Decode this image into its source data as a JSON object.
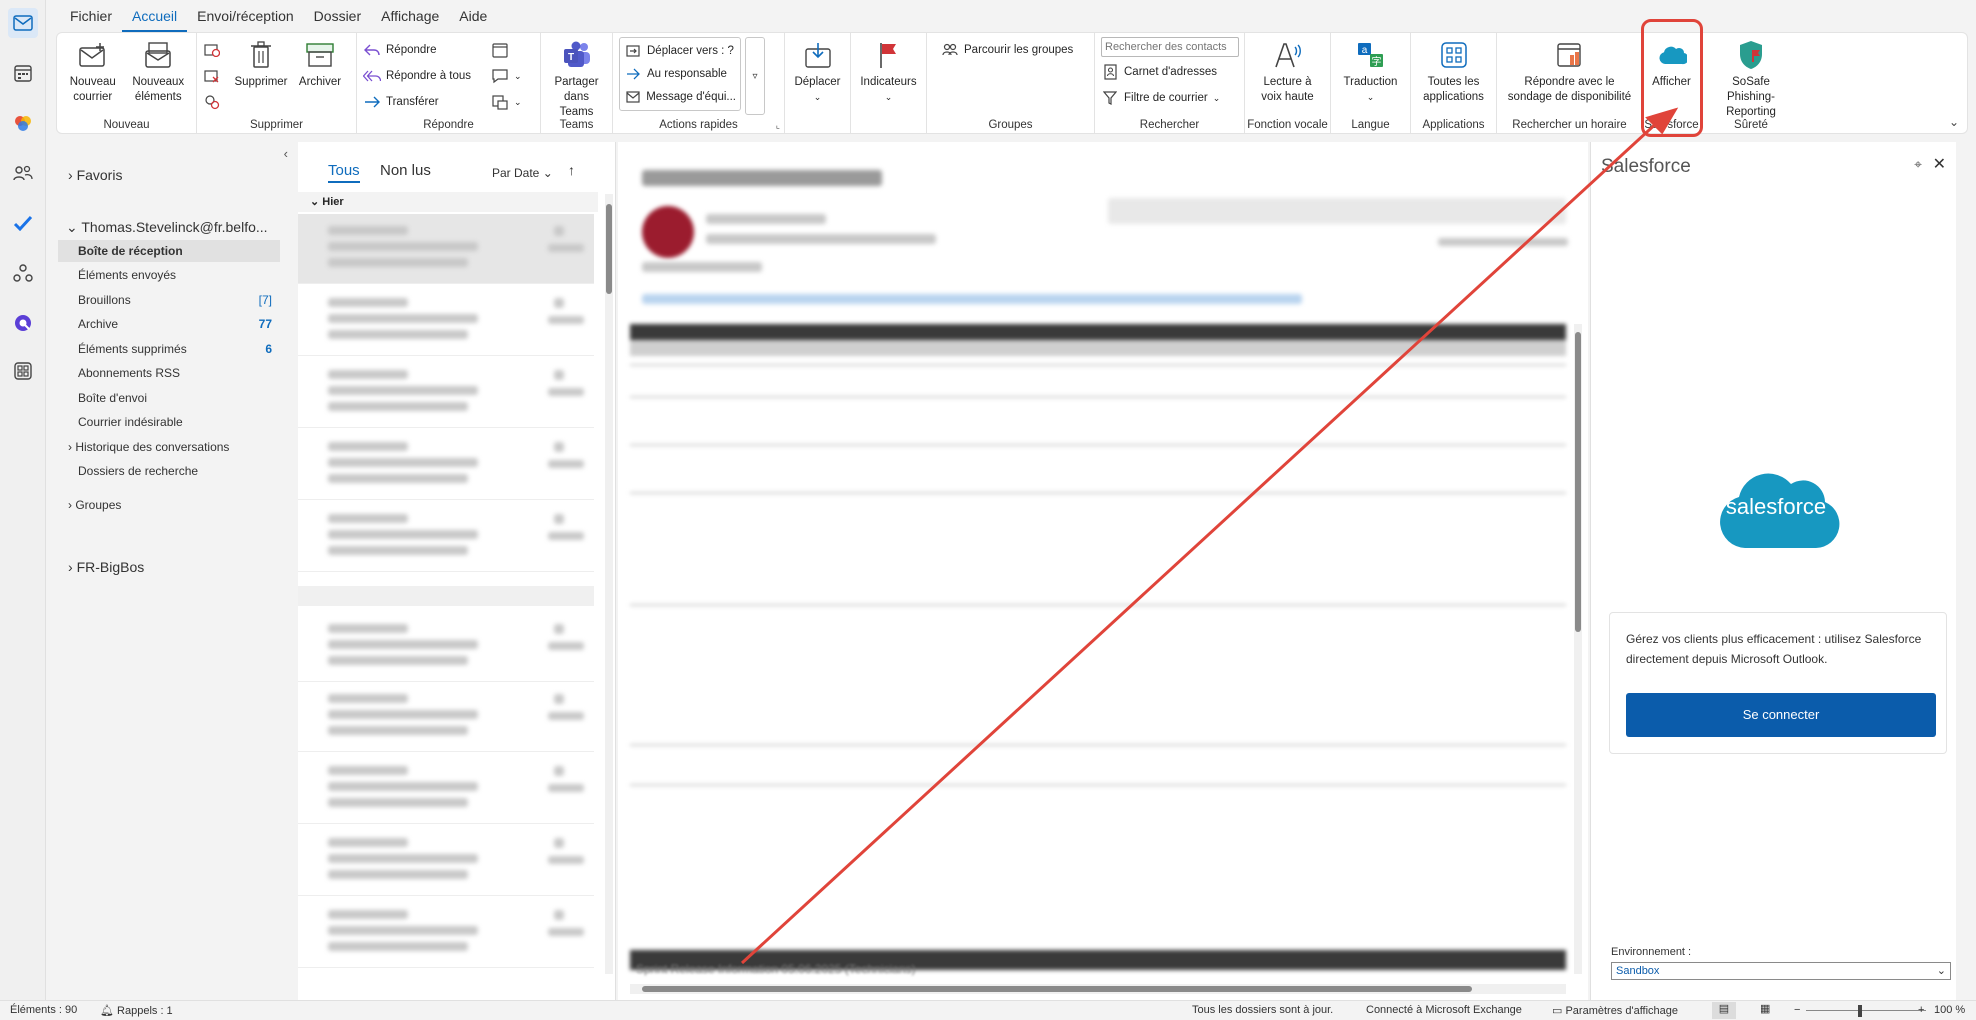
{
  "menu": [
    "Fichier",
    "Accueil",
    "Envoi/réception",
    "Dossier",
    "Affichage",
    "Aide"
  ],
  "ribbon": {
    "new_mail": "Nouveau courrier",
    "new_items": "Nouveaux éléments",
    "group_new": "Nouveau",
    "delete": "Supprimer",
    "archive": "Archiver",
    "group_delete": "Supprimer",
    "reply": "Répondre",
    "reply_all": "Répondre à tous",
    "forward": "Transférer",
    "group_reply": "Répondre",
    "share_teams": "Partager dans Teams",
    "group_teams": "Teams",
    "move_to": "Déplacer vers : ?",
    "to_manager": "Au responsable",
    "team_message": "Message d'équi...",
    "group_quick": "Actions rapides",
    "move": "Déplacer",
    "flags": "Indicateurs",
    "browse_groups": "Parcourir les groupes",
    "group_groups": "Groupes",
    "search_contacts_placeholder": "Rechercher des contacts",
    "address_book": "Carnet d'adresses",
    "filter_mail": "Filtre de courrier",
    "group_search": "Rechercher",
    "read_aloud": "Lecture à voix haute",
    "group_voice": "Fonction vocale",
    "translate": "Traduction",
    "group_language": "Langue",
    "all_apps": "Toutes les applications",
    "group_apps": "Applications",
    "reply_poll": "Répondre avec le sondage de disponibilité",
    "group_schedule": "Rechercher un horaire",
    "show_sf": "Afficher",
    "group_sf": "Salesforce",
    "sosafe": "SoSafe Phishing-Reporting",
    "group_safety": "Sûreté"
  },
  "folders": {
    "favorites": "Favoris",
    "account": "Thomas.Stevelinck@fr.belfo...",
    "inbox": "Boîte de réception",
    "sent": "Éléments envoyés",
    "drafts": "Brouillons",
    "drafts_count": "[7]",
    "archive": "Archive",
    "archive_count": "77",
    "deleted": "Éléments supprimés",
    "deleted_count": "6",
    "rss": "Abonnements RSS",
    "outbox": "Boîte d'envoi",
    "junk": "Courrier indésirable",
    "history": "Historique des conversations",
    "search_folders": "Dossiers de recherche",
    "groups": "Groupes",
    "fr_bigbos": "FR-BigBos"
  },
  "list": {
    "tab_all": "Tous",
    "tab_unread": "Non lus",
    "sort": "Par Date",
    "section_yesterday": "Hier"
  },
  "reading": {
    "footer_text": "Sprint Release Information 05.06.2025 (Technicians)"
  },
  "salesforce": {
    "title": "Salesforce",
    "logo_text": "salesforce",
    "description": "Gérez vos clients plus efficacement : utilisez Salesforce directement depuis Microsoft Outlook.",
    "connect": "Se connecter",
    "env_label": "Environnement :",
    "env_value": "Sandbox"
  },
  "status": {
    "items": "Éléments : 90",
    "reminders": "Rappels : 1",
    "sync": "Tous les dossiers sont à jour.",
    "exchange": "Connecté à Microsoft Exchange",
    "display_settings": "Paramètres d'affichage",
    "zoom": "100 %"
  },
  "colors": {
    "accent": "#0f6cbd",
    "salesforce_blue": "#1798c1",
    "highlight_red": "#e0443a"
  }
}
